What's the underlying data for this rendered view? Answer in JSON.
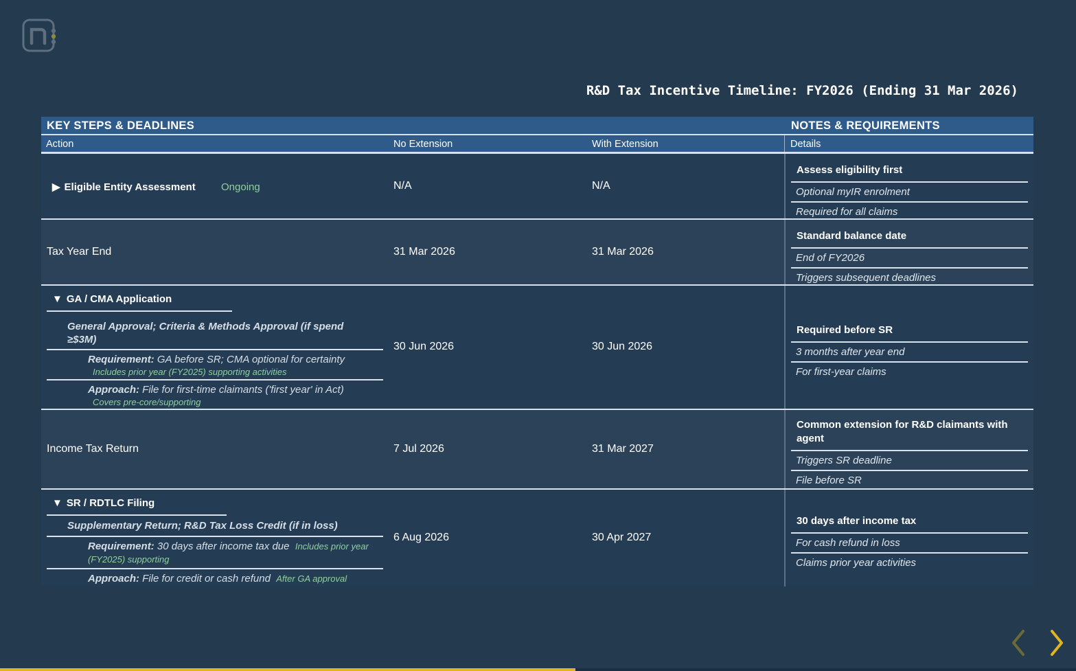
{
  "title": "R&D Tax Incentive Timeline: FY2026 (Ending 31 Mar 2026)",
  "headers": {
    "section_left": "KEY STEPS & DEADLINES",
    "section_right": "NOTES & REQUIREMENTS",
    "col_action": "Action",
    "col_no_ext": "No Extension",
    "col_with_ext": "With Extension",
    "col_details": "Details"
  },
  "rows": [
    {
      "action": "Eligible Entity Assessment",
      "status": "Ongoing",
      "no_ext": "N/A",
      "with_ext": "N/A",
      "note_head": "Assess eligibility first",
      "note_1": "Optional myIR enrolment",
      "note_2": "Required for all claims"
    },
    {
      "action": "Tax Year End",
      "no_ext": "31 Mar 2026",
      "with_ext": "31 Mar 2026",
      "note_head": "Standard balance date",
      "note_1": "End of FY2026",
      "note_2": "Triggers subsequent deadlines"
    },
    {
      "action": "GA / CMA Application",
      "subtitle": "General Approval; Criteria & Methods Approval (if spend ≥$3M)",
      "req_label": "Requirement:",
      "req_text": "GA before SR; CMA optional for certainty",
      "req_note": "Includes prior year (FY2025) supporting activities",
      "app_label": "Approach:",
      "app_text": "File for first-time claimants ('first year' in Act)",
      "app_note": "Covers pre-core/supporting",
      "no_ext": "30 Jun 2026",
      "with_ext": "30 Jun 2026",
      "note_head": "Required before SR",
      "note_1": "3 months after year end",
      "note_2": "For first-year claims"
    },
    {
      "action": "Income Tax Return",
      "no_ext": "7 Jul 2026",
      "with_ext": "31 Mar 2027",
      "note_head": "Common extension for R&D claimants with agent",
      "note_1": "Triggers SR deadline",
      "note_2": "File before SR"
    },
    {
      "action": "SR / RDTLC Filing",
      "subtitle": "Supplementary Return; R&D Tax Loss Credit (if in loss)",
      "req_label": "Requirement:",
      "req_text": "30 days after income tax due",
      "req_note": "Includes prior year (FY2025) supporting",
      "app_label": "Approach:",
      "app_text": "File for credit or cash refund",
      "app_note": "After GA approval",
      "no_ext": "6 Aug 2026",
      "with_ext": "30 Apr 2027",
      "note_head": "30 days after income tax",
      "note_1": "For cash refund in loss",
      "note_2": "Claims prior year activities"
    }
  ],
  "carets": {
    "collapsed": "▶",
    "expanded": "▼"
  },
  "progress": 0.535,
  "colors": {
    "background": "#233a4f",
    "header": "#2e5b8a",
    "accent": "#e0b51f",
    "green": "#8fd19e"
  }
}
